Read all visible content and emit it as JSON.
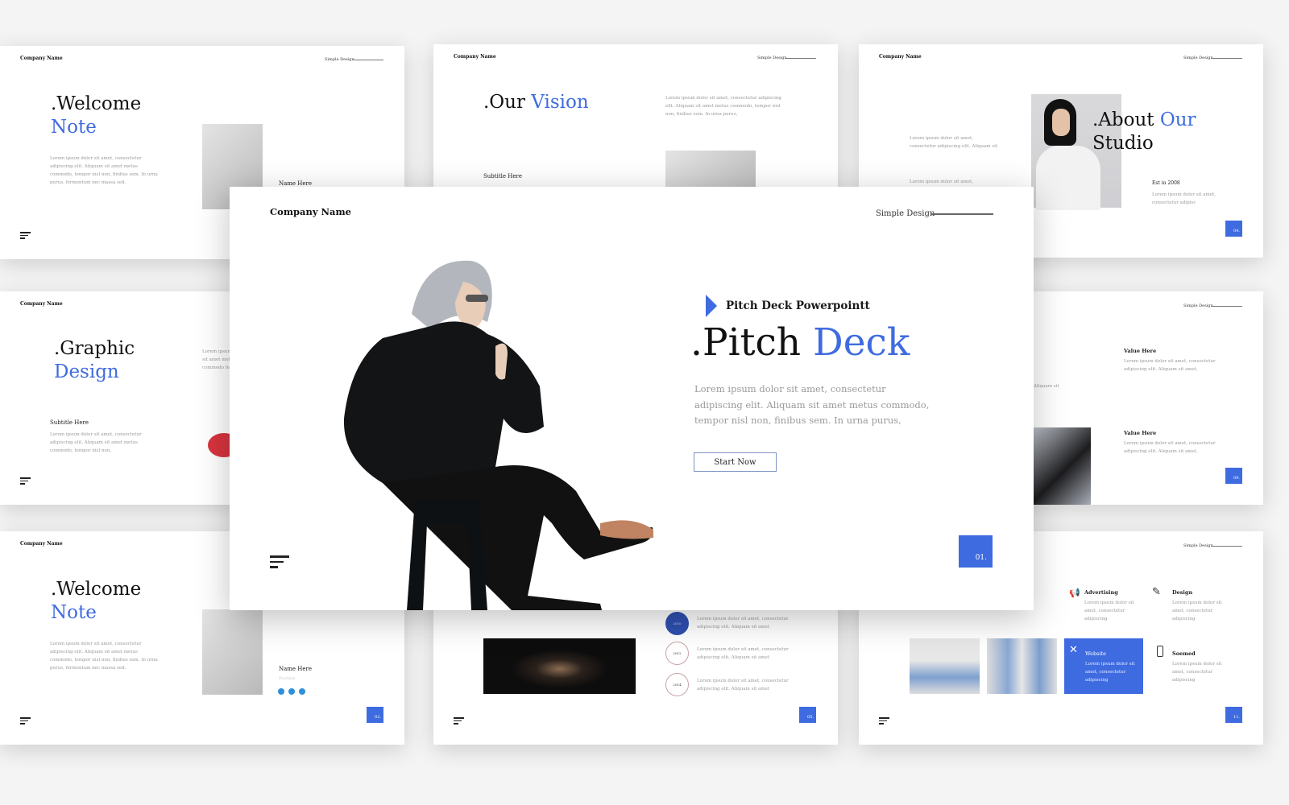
{
  "common": {
    "company": "Company Name",
    "simple_design": "Simple Design"
  },
  "slide_welcome": {
    "title_1": ".Welcome",
    "title_2": "Note",
    "body": "Lorem ipsum dolor sit amet, consectetur adipiscing elit. Aliquam sit amet metus commodo, tempor nisl non, finibus sem. In urna purus, fermentum nec massa sed.",
    "name": "Name Here",
    "position": "Position",
    "page": "02."
  },
  "slide_vision": {
    "title_1": ".Our",
    "title_2": "Vision",
    "body": "Lorem ipsum dolor sit amet, consectetur adipiscing elit. Aliquam sit amet metus commodo, tempor nisl non, finibus sem. In urna purus,",
    "subtitle": "Subtitle Here"
  },
  "slide_about": {
    "title_1": ".About",
    "title_2": "Our",
    "title_3": "Studio",
    "text_1": "Lorem ipsum dolor sit amet, consectetur adipiscing elit. Aliquam sit",
    "text_2": "Lorem ipsum dolor sit amet, consectetur",
    "est": "Est in 2008",
    "est_body": "Lorem ipsum dolor sit amet, consectetur adipisc",
    "page": "04."
  },
  "slide_graphic": {
    "title_1": ".Graphic",
    "title_2": "Design",
    "subtitle": "Subtitle Here",
    "body": "Lorem ipsum dolor sit amet, consectetur adipiscing elit. Aliquam sit amet metus commodo, tempor nisl non,",
    "side_text": "Lorem ipsum dolor sit amet metus commodo fermentum"
  },
  "slide_values": {
    "items": [
      {
        "title": "Value Here",
        "body": "Lorem ipsum dolor sit amet, consectetur adipiscing elit. Aliquam sit amet,"
      },
      {
        "title": "Value Here",
        "body": "Lorem ipsum dolor sit amet, consectetur adipiscing elit. Aliquam sit amet,"
      }
    ],
    "side_text": "Aliquam sit",
    "page": "09."
  },
  "slide_timeline": {
    "items": [
      {
        "year": "2010",
        "text": "Lorem ipsum dolor sit amet, consectetur adipiscing elit. Aliquam sit amet"
      },
      {
        "year": "2012",
        "text": "Lorem ipsum dolor sit amet, consectetur adipiscing elit. Aliquam sit amet"
      },
      {
        "year": "2014",
        "text": "Lorem ipsum dolor sit amet, consectetur adipiscing elit. Aliquam sit amet"
      }
    ],
    "page": "05."
  },
  "slide_services": {
    "items": [
      {
        "icon": "megaphone-icon",
        "title": "Advertising",
        "body": "Lorem ipsum dolor sit amet, consectetur adipiscing"
      },
      {
        "icon": "pencil-ruler-icon",
        "title": "Design",
        "body": "Lorem ipsum dolor sit amet, consectetur adipiscing"
      },
      {
        "icon": "tools-icon",
        "title": "Website",
        "body": "Lorem ipsum dolor sit amet, consectetur adipiscing"
      },
      {
        "icon": "phone-icon",
        "title": "Soemed",
        "body": "Lorem ipsum dolor sit amet, consectetur adipiscing"
      }
    ],
    "page": "11."
  },
  "main": {
    "kicker": "Pitch Deck Powerpointt",
    "title_1": ".Pitch",
    "title_2": "Deck",
    "body": "Lorem ipsum dolor sit amet, consectetur adipiscing elit. Aliquam sit amet metus commodo, tempor nisl non, finibus sem. In urna purus,",
    "button": "Start Now",
    "page": "01."
  },
  "colors": {
    "accent": "#3f6be0",
    "text": "#111111",
    "muted": "#999999"
  }
}
